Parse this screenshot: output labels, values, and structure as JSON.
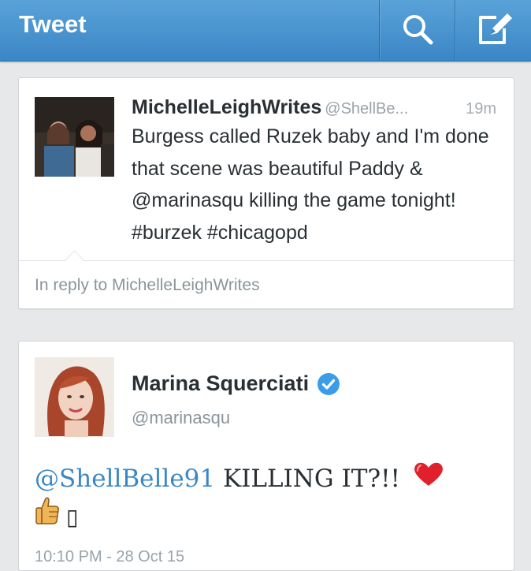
{
  "action_bar": {
    "title": "Tweet",
    "icons": [
      "search-icon",
      "compose-icon"
    ],
    "color": "#4493d0"
  },
  "reply_tweet": {
    "author_name": "MichelleLeighWrites",
    "author_handle": "@ShellBe...",
    "time": "19m",
    "text": "Burgess called Ruzek baby and I'm done that scene was beautiful Paddy & @marinasqu killing the game tonight! #burzek #chicagopd",
    "in_reply_to": "In reply to MichelleLeighWrites"
  },
  "main_tweet": {
    "author_name": "Marina Squerciati",
    "author_handle": "@marinasqu",
    "verified": true,
    "mention": "@ShellBelle91",
    "text": " KILLING IT?!!",
    "emoji": [
      "red-heart-icon",
      "thumbs-up-icon"
    ],
    "missing_glyph": "▯",
    "timestamp": "10:10 PM - 28 Oct 15"
  },
  "colors": {
    "link": "#3b87c4",
    "verified_badge": "#3b9ce8",
    "heart": "#e0212b"
  }
}
